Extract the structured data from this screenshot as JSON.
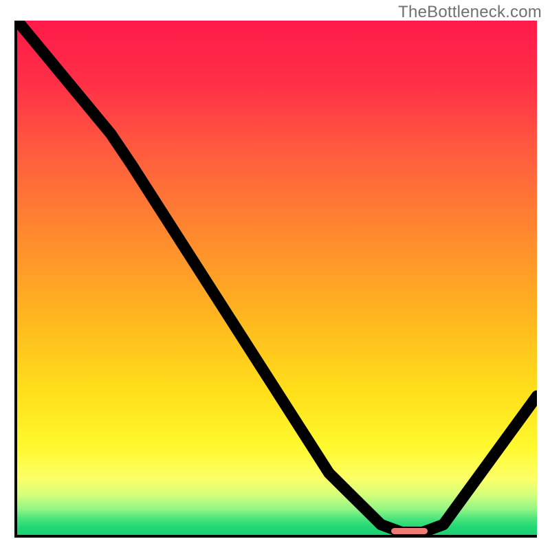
{
  "watermark": "TheBottleneck.com",
  "chart_data": {
    "type": "line",
    "title": "",
    "xlabel": "",
    "ylabel": "",
    "xlim": [
      0,
      100
    ],
    "ylim": [
      0,
      100
    ],
    "grid": false,
    "series": [
      {
        "name": "bottleneck-curve",
        "x": [
          0,
          18,
          22,
          60,
          70,
          74,
          78,
          82,
          100
        ],
        "values": [
          100,
          78,
          72,
          12,
          2,
          0.5,
          0.5,
          2,
          27
        ]
      }
    ],
    "annotations": [
      {
        "name": "optimal-range-marker",
        "x_start": 72,
        "x_end": 79,
        "y": 0.5,
        "color": "#ef7b79"
      }
    ],
    "background": {
      "type": "vertical-gradient",
      "stops": [
        {
          "pos": 0.0,
          "color": "#ff1a4a"
        },
        {
          "pos": 0.12,
          "color": "#ff2f47"
        },
        {
          "pos": 0.25,
          "color": "#ff5a3f"
        },
        {
          "pos": 0.42,
          "color": "#ff8a2e"
        },
        {
          "pos": 0.58,
          "color": "#ffb71f"
        },
        {
          "pos": 0.72,
          "color": "#ffdf1a"
        },
        {
          "pos": 0.83,
          "color": "#fff92e"
        },
        {
          "pos": 0.89,
          "color": "#fdff66"
        },
        {
          "pos": 0.92,
          "color": "#d7ff7a"
        },
        {
          "pos": 0.95,
          "color": "#92f584"
        },
        {
          "pos": 0.97,
          "color": "#46e37c"
        },
        {
          "pos": 0.985,
          "color": "#22d775"
        },
        {
          "pos": 1.0,
          "color": "#1bd072"
        }
      ]
    }
  }
}
